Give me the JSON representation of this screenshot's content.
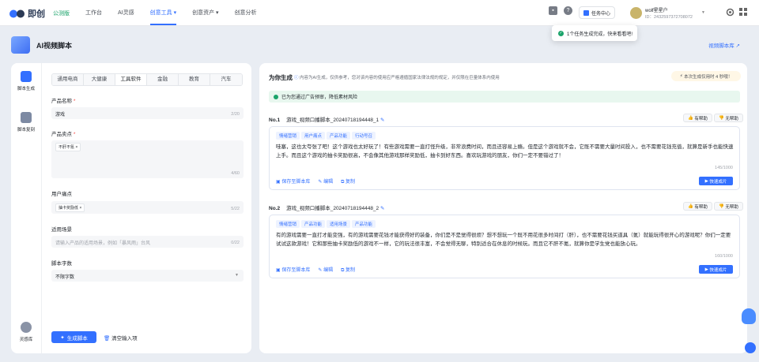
{
  "app": {
    "brand": "即创",
    "workspace": "公测版"
  },
  "topnav": [
    "工作台",
    "AI灵感",
    "创意工具 ▾",
    "创意资产 ▾",
    "创意分析"
  ],
  "topright": {
    "task_label": "任务中心",
    "user_name": "wolf星星户",
    "user_id": "ID：2432597372708072"
  },
  "toast": {
    "text": "1个任务生成完成，快来看看吧!"
  },
  "page": {
    "title": "AI视频脚本",
    "library_link": "视频脚本库 ↗"
  },
  "sidebar": [
    {
      "label": "脚本生成"
    },
    {
      "label": "脚本复刻"
    },
    {
      "label": "灵感库"
    }
  ],
  "tabs": [
    "通用电商",
    "大健康",
    "工具软件",
    "金融",
    "教育",
    "汽车"
  ],
  "form": {
    "product_name": {
      "label": "产品名称",
      "req": "*",
      "value": "游戏",
      "count": "2/20"
    },
    "selling_point": {
      "label": "产品卖点",
      "req": "*",
      "chip": "不肝不氪 ×",
      "count": "4/60"
    },
    "pain_point": {
      "label": "用户痛点",
      "chip": "抽卡奖励低 ×",
      "count": "5/22"
    },
    "scenario": {
      "label": "适用场景",
      "placeholder": "请输入产品的适用场景，例如「暴风雨」台风",
      "count": "0/22"
    },
    "word_count": {
      "label": "脚本字数",
      "value": "不限字数"
    },
    "generate_btn": "生成脚本",
    "clear_btn": "清空输入项"
  },
  "right": {
    "title": "为你生成",
    "info": "内容为AI生成，仅供参考，您对该内容的使用应严格遵循国家法律法规的规定，并仅限在巨量体系内使用",
    "time_hint": "本次生成仅用时 4 秒哦！",
    "ok_bar": "已为您通过广告预审，降低素材风险",
    "entries": [
      {
        "no": "No.1",
        "name": "游戏_视频口播脚本_20240718194448_1",
        "tags": [
          "情绪营销",
          "用户痛点",
          "产品功能",
          "行动号召"
        ],
        "text": "哇塞，这也太夸张了吧！这个游戏也太好玩了！有些游戏需要一直打怪升级，非常浪费时间，而且还容易上瘾。但是这个游戏就不会，它既不需要大量时间投入，也不需要花钱充值，就算是新手也能快速上手。而且这个游戏的抽卡奖励很高，不会像其他游戏那样奖励低，抽卡到好东西。喜欢玩游戏的朋友，你们一定不要错过了！",
        "count": "145/1000",
        "like": "有帮助",
        "dislike": "无帮助",
        "actions": [
          "保存至脚本库",
          "编辑",
          "复制"
        ],
        "quick": "快速成片"
      },
      {
        "no": "No.2",
        "name": "游戏_视频口播脚本_20240718194448_2",
        "tags": [
          "情绪营销",
          "产品功能",
          "适用场景",
          "产品功能"
        ],
        "text": "有的游戏需要一直打才能变强，有的游戏需要花钱才能获得好的装备，你们是不是觉得很烦？想不想玩一个既不用花很多时间打（肝），也不需要花钱买道具（氪）就能玩得很开心的游戏呢？你们一定要试试这款游戏！它和那些抽卡奖励低的游戏不一样，它的玩法很丰富，不会觉得无聊，特别适合在休息的时候玩。而且它不肝不氪，就算你是学生党也能放心玩。",
        "count": "160/1000",
        "like": "有帮助",
        "dislike": "无帮助",
        "actions": [
          "保存至脚本库",
          "编辑",
          "复制"
        ],
        "quick": "快速成片"
      }
    ]
  }
}
